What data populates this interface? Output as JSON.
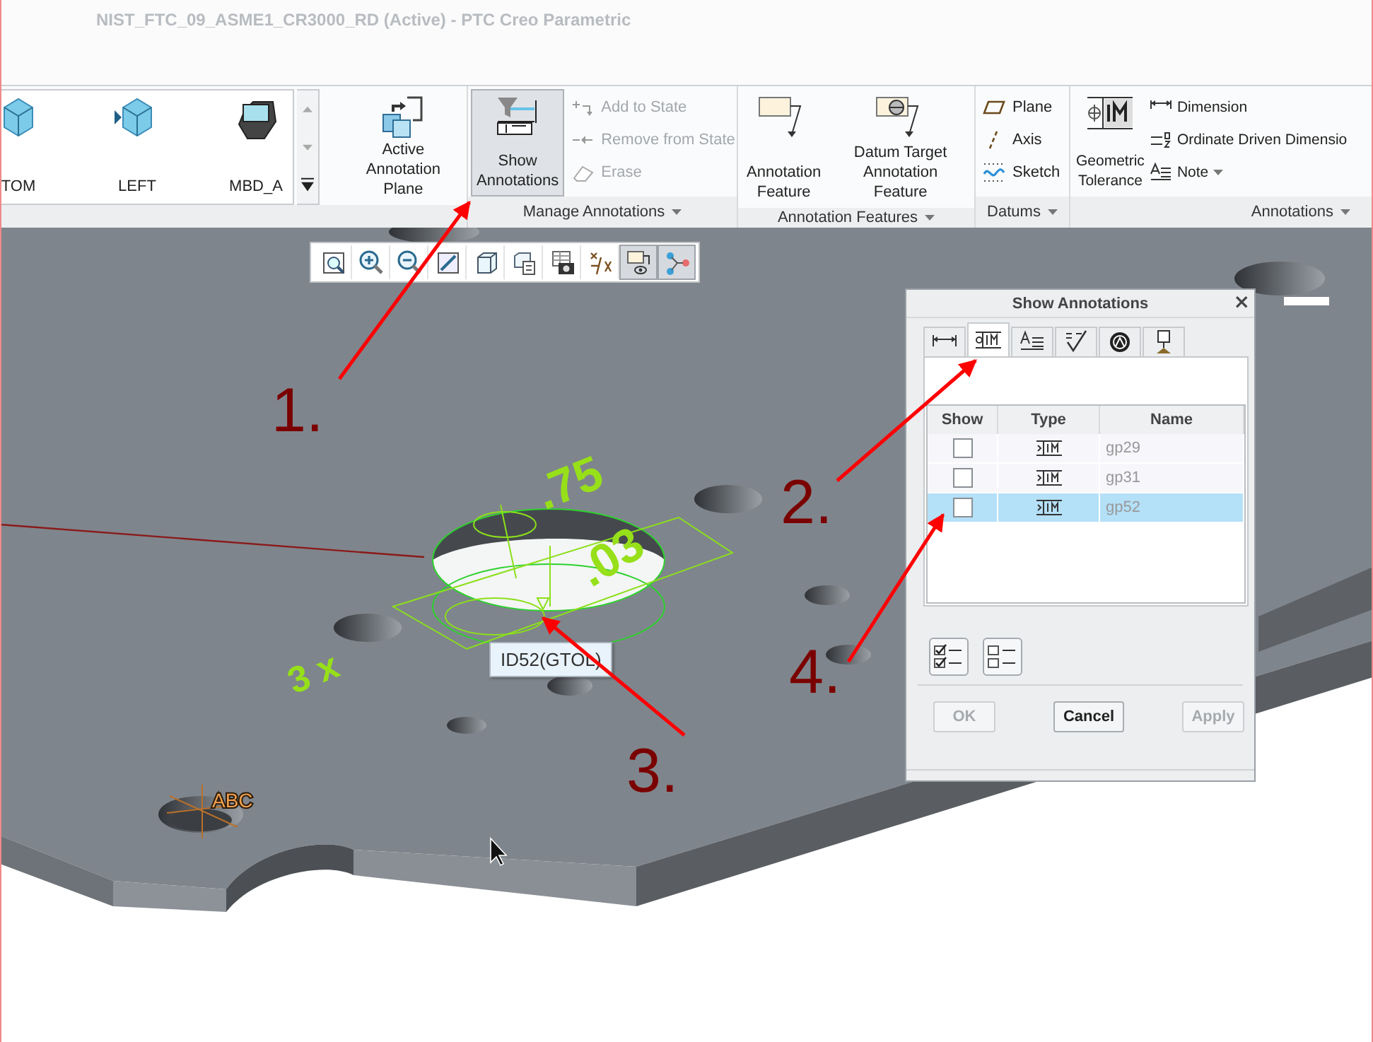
{
  "window": {
    "title": "NIST_FTC_09_ASME1_CR3000_RD (Active) - PTC Creo Parametric"
  },
  "ribbon": {
    "groups": [
      {
        "items": [
          {
            "kind": "gallery",
            "views": [
              {
                "label": "TOM"
              },
              {
                "label": "LEFT"
              },
              {
                "label": "MBD_A"
              }
            ]
          },
          {
            "kind": "large",
            "label": "Active\nAnnotation Plane",
            "selected": false
          }
        ]
      },
      {
        "label": "Manage Annotations",
        "items": [
          {
            "kind": "large",
            "label": "Show\nAnnotations",
            "selected": true
          },
          {
            "kind": "small",
            "entries": [
              {
                "label": "Add to State",
                "disabled": true
              },
              {
                "label": "Remove from State",
                "disabled": true
              },
              {
                "label": "Erase",
                "disabled": true
              }
            ]
          }
        ]
      },
      {
        "label": "Annotation Features",
        "items": [
          {
            "kind": "large",
            "label": "Annotation\nFeature",
            "selected": false
          },
          {
            "kind": "large",
            "label": "Datum Target\nAnnotation Feature",
            "selected": false
          }
        ]
      },
      {
        "label": "Datums",
        "items": [
          {
            "kind": "small",
            "entries": [
              {
                "label": "Plane",
                "disabled": false
              },
              {
                "label": "Axis",
                "disabled": false
              },
              {
                "label": "Sketch",
                "disabled": false
              }
            ]
          }
        ]
      },
      {
        "label": "Annotations",
        "items": [
          {
            "kind": "large",
            "label": "Geometric\nTolerance",
            "selected": false
          },
          {
            "kind": "small",
            "entries": [
              {
                "label": "Dimension",
                "disabled": false
              },
              {
                "label": "Ordinate Driven Dimensio",
                "disabled": false
              },
              {
                "label": "Note",
                "disabled": false,
                "has_menu": true
              }
            ]
          }
        ]
      }
    ]
  },
  "toolbar": [
    {
      "selected": false
    },
    {
      "selected": false
    },
    {
      "selected": false
    },
    {
      "selected": false
    },
    {
      "selected": false
    },
    {
      "selected": false
    },
    {
      "selected": false
    },
    {
      "selected": false
    },
    {
      "selected": true
    },
    {
      "selected": true
    }
  ],
  "scene": {
    "annotations": [
      {
        "kind": "dimension",
        "text": ".75"
      },
      {
        "kind": "tolerance",
        "text": ".03"
      },
      {
        "kind": "count",
        "text": "3 x"
      },
      {
        "kind": "datum",
        "text": "ABC"
      }
    ],
    "tooltip": "ID52(GTOL)",
    "callouts": [
      {
        "label": "1."
      },
      {
        "label": "2."
      },
      {
        "label": "3."
      },
      {
        "label": "4."
      }
    ]
  },
  "dialog": {
    "title": "Show Annotations",
    "close": "×",
    "tabs": [
      {
        "selected": false
      },
      {
        "selected": true
      },
      {
        "selected": false
      },
      {
        "selected": false
      },
      {
        "selected": false
      },
      {
        "selected": false
      }
    ],
    "columns": [
      "Show",
      "Type",
      "Name"
    ],
    "rows": [
      {
        "show": false,
        "name": "gp29",
        "selected": false
      },
      {
        "show": false,
        "name": "gp31",
        "selected": false
      },
      {
        "show": false,
        "name": "gp52",
        "selected": true
      }
    ],
    "buttons": [
      {
        "label": "OK",
        "disabled": true
      },
      {
        "label": "Cancel",
        "disabled": false
      },
      {
        "label": "Apply",
        "disabled": true
      }
    ]
  }
}
